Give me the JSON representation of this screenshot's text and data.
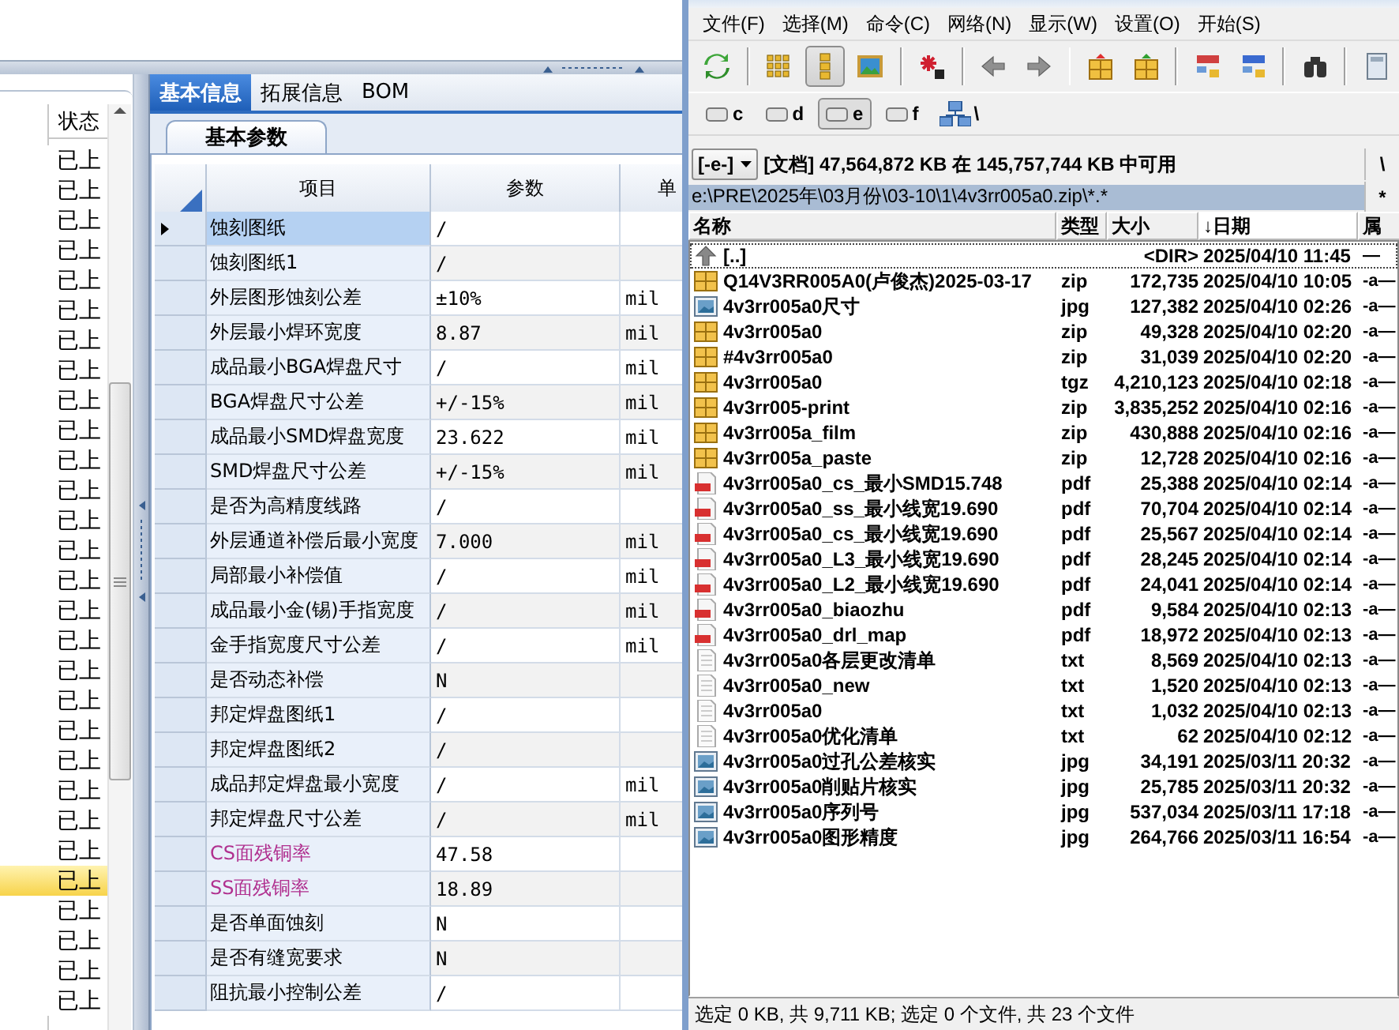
{
  "left_app": {
    "status_list": {
      "header": "状态",
      "rows": [
        {
          "text": "已上",
          "selected": false
        },
        {
          "text": "已上",
          "selected": false
        },
        {
          "text": "已上",
          "selected": false
        },
        {
          "text": "已上",
          "selected": false
        },
        {
          "text": "已上",
          "selected": false
        },
        {
          "text": "已上",
          "selected": false
        },
        {
          "text": "已上",
          "selected": false
        },
        {
          "text": "已上",
          "selected": false
        },
        {
          "text": "已上",
          "selected": false
        },
        {
          "text": "已上",
          "selected": false
        },
        {
          "text": "已上",
          "selected": false
        },
        {
          "text": "已上",
          "selected": false
        },
        {
          "text": "已上",
          "selected": false
        },
        {
          "text": "已上",
          "selected": false
        },
        {
          "text": "已上",
          "selected": false
        },
        {
          "text": "已上",
          "selected": false
        },
        {
          "text": "已上",
          "selected": false
        },
        {
          "text": "已上",
          "selected": false
        },
        {
          "text": "已上",
          "selected": false
        },
        {
          "text": "已上",
          "selected": false
        },
        {
          "text": "已上",
          "selected": false
        },
        {
          "text": "已上",
          "selected": false
        },
        {
          "text": "已上",
          "selected": false
        },
        {
          "text": "已上",
          "selected": false
        },
        {
          "text": "已上",
          "selected": true
        },
        {
          "text": "已上",
          "selected": false
        },
        {
          "text": "已上",
          "selected": false
        },
        {
          "text": "已上",
          "selected": false
        },
        {
          "text": "已上",
          "selected": false
        }
      ]
    },
    "tabs": [
      {
        "label": "基本信息",
        "selected": true
      },
      {
        "label": "拓展信息",
        "selected": false
      },
      {
        "label": "BOM",
        "selected": false
      }
    ],
    "sub_tabs": [
      {
        "label": "基本参数",
        "selected": true
      }
    ],
    "grid": {
      "columns": [
        "项目",
        "参数",
        "单"
      ],
      "rows": [
        {
          "item": "蚀刻图纸",
          "param": "/",
          "selected": true,
          "color": "#000000"
        },
        {
          "item": "蚀刻图纸1",
          "param": "/",
          "selected": false,
          "color": "#000000"
        },
        {
          "item": "外层图形蚀刻公差",
          "param": "±10%",
          "unit": "mil",
          "selected": false,
          "color": "#000000"
        },
        {
          "item": "外层最小焊环宽度",
          "param": "8.87",
          "unit": "mil",
          "selected": false,
          "color": "#000000"
        },
        {
          "item": "成品最小BGA焊盘尺寸",
          "param": "/",
          "unit": "mil",
          "selected": false,
          "color": "#000000"
        },
        {
          "item": "BGA焊盘尺寸公差",
          "param": "+/-15%",
          "unit": "mil",
          "selected": false,
          "color": "#000000"
        },
        {
          "item": "成品最小SMD焊盘宽度",
          "param": "23.622",
          "unit": "mil",
          "selected": false,
          "color": "#000000"
        },
        {
          "item": "SMD焊盘尺寸公差",
          "param": "+/-15%",
          "unit": "mil",
          "selected": false,
          "color": "#000000"
        },
        {
          "item": "是否为高精度线路",
          "param": "/",
          "selected": false,
          "color": "#000000"
        },
        {
          "item": "外层通道补偿后最小宽度",
          "param": "7.000",
          "unit": "mil",
          "selected": false,
          "color": "#000000"
        },
        {
          "item": "局部最小补偿值",
          "param": "/",
          "unit": "mil",
          "selected": false,
          "color": "#000000"
        },
        {
          "item": "成品最小金(锡)手指宽度",
          "param": "/",
          "unit": "mil",
          "selected": false,
          "color": "#000000"
        },
        {
          "item": "金手指宽度尺寸公差",
          "param": "/",
          "unit": "mil",
          "selected": false,
          "color": "#000000"
        },
        {
          "item": "是否动态补偿",
          "param": "N",
          "selected": false,
          "color": "#000000"
        },
        {
          "item": "邦定焊盘图纸1",
          "param": "/",
          "selected": false,
          "color": "#000000"
        },
        {
          "item": "邦定焊盘图纸2",
          "param": "/",
          "selected": false,
          "color": "#000000"
        },
        {
          "item": "成品邦定焊盘最小宽度",
          "param": "/",
          "unit": "mil",
          "selected": false,
          "color": "#000000"
        },
        {
          "item": "邦定焊盘尺寸公差",
          "param": "/",
          "unit": "mil",
          "selected": false,
          "color": "#000000"
        },
        {
          "item": "CS面残铜率",
          "param": "47.58",
          "selected": false,
          "color": "#b0308f"
        },
        {
          "item": "SS面残铜率",
          "param": "18.89",
          "selected": false,
          "color": "#b0308f"
        },
        {
          "item": "是否单面蚀刻",
          "param": "N",
          "selected": false,
          "color": "#000000"
        },
        {
          "item": "是否有缝宽要求",
          "param": "N",
          "selected": false,
          "color": "#000000"
        },
        {
          "item": "阻抗最小控制公差",
          "param": "/",
          "selected": false,
          "color": "#000000"
        }
      ]
    }
  },
  "file_manager": {
    "menu": [
      "文件(F)",
      "选择(M)",
      "命令(C)",
      "网络(N)",
      "显示(W)",
      "设置(O)",
      "开始(S)"
    ],
    "toolbar": [
      [
        {
          "pressed": false
        }
      ],
      [
        {
          "pressed": false
        },
        {
          "pressed": true
        },
        {
          "pressed": false
        }
      ],
      [
        {
          "pressed": false
        }
      ],
      [
        {
          "pressed": false
        },
        {
          "pressed": false
        }
      ],
      [
        {
          "pressed": false
        },
        {
          "pressed": false
        }
      ],
      [
        {
          "pressed": false
        },
        {
          "pressed": false
        }
      ],
      [
        {
          "pressed": false
        }
      ],
      [
        {
          "pressed": false
        }
      ]
    ],
    "drives": [
      {
        "label": "c",
        "selected": false
      },
      {
        "label": "d",
        "selected": false
      },
      {
        "label": "e",
        "selected": true
      },
      {
        "label": "f",
        "selected": false
      }
    ],
    "network_label": "\\",
    "drive_dropdown": "[-e-]",
    "free_space": "[文档] 47,564,872 KB 在 145,757,744 KB 中可用",
    "root_button": "\\",
    "path": "e:\\PRE\\2025年\\03月份\\03-10\\1\\4v3rr005a0.zip\\*.*",
    "history_button": "*",
    "columns": [
      {
        "label": "名称",
        "sorted": false
      },
      {
        "label": "类型",
        "sorted": false
      },
      {
        "label": "大小",
        "sorted": false
      },
      {
        "label": "↓日期",
        "sorted": true
      },
      {
        "label": "属",
        "sorted": false
      }
    ],
    "files": [
      {
        "kind": "up",
        "name": "[..]",
        "size": "<DIR>",
        "date": "2025/04/10 11:45",
        "attr": "—",
        "focused": true
      },
      {
        "kind": "archive",
        "name": "Q14V3RR005A0(卢俊杰)2025-03-17",
        "type": "zip",
        "size": "172,735",
        "date": "2025/04/10 10:05",
        "attr": "-a—",
        "focused": false
      },
      {
        "kind": "image",
        "name": "4v3rr005a0尺寸",
        "type": "jpg",
        "size": "127,382",
        "date": "2025/04/10 02:26",
        "attr": "-a—",
        "focused": false
      },
      {
        "kind": "archive",
        "name": "4v3rr005a0",
        "type": "zip",
        "size": "49,328",
        "date": "2025/04/10 02:20",
        "attr": "-a—",
        "focused": false
      },
      {
        "kind": "archive",
        "name": "#4v3rr005a0",
        "type": "zip",
        "size": "31,039",
        "date": "2025/04/10 02:20",
        "attr": "-a—",
        "focused": false
      },
      {
        "kind": "archive",
        "name": "4v3rr005a0",
        "type": "tgz",
        "size": "4,210,123",
        "date": "2025/04/10 02:18",
        "attr": "-a—",
        "focused": false
      },
      {
        "kind": "archive",
        "name": "4v3rr005-print",
        "type": "zip",
        "size": "3,835,252",
        "date": "2025/04/10 02:16",
        "attr": "-a—",
        "focused": false
      },
      {
        "kind": "archive",
        "name": "4v3rr005a_film",
        "type": "zip",
        "size": "430,888",
        "date": "2025/04/10 02:16",
        "attr": "-a—",
        "focused": false
      },
      {
        "kind": "archive",
        "name": "4v3rr005a_paste",
        "type": "zip",
        "size": "12,728",
        "date": "2025/04/10 02:16",
        "attr": "-a—",
        "focused": false
      },
      {
        "kind": "pdf",
        "name": "4v3rr005a0_cs_最小SMD15.748",
        "type": "pdf",
        "size": "25,388",
        "date": "2025/04/10 02:14",
        "attr": "-a—",
        "focused": false
      },
      {
        "kind": "pdf",
        "name": "4v3rr005a0_ss_最小线宽19.690",
        "type": "pdf",
        "size": "70,704",
        "date": "2025/04/10 02:14",
        "attr": "-a—",
        "focused": false
      },
      {
        "kind": "pdf",
        "name": "4v3rr005a0_cs_最小线宽19.690",
        "type": "pdf",
        "size": "25,567",
        "date": "2025/04/10 02:14",
        "attr": "-a—",
        "focused": false
      },
      {
        "kind": "pdf",
        "name": "4v3rr005a0_L3_最小线宽19.690",
        "type": "pdf",
        "size": "28,245",
        "date": "2025/04/10 02:14",
        "attr": "-a—",
        "focused": false
      },
      {
        "kind": "pdf",
        "name": "4v3rr005a0_L2_最小线宽19.690",
        "type": "pdf",
        "size": "24,041",
        "date": "2025/04/10 02:14",
        "attr": "-a—",
        "focused": false
      },
      {
        "kind": "pdf",
        "name": "4v3rr005a0_biaozhu",
        "type": "pdf",
        "size": "9,584",
        "date": "2025/04/10 02:13",
        "attr": "-a—",
        "focused": false
      },
      {
        "kind": "pdf",
        "name": "4v3rr005a0_drl_map",
        "type": "pdf",
        "size": "18,972",
        "date": "2025/04/10 02:13",
        "attr": "-a—",
        "focused": false
      },
      {
        "kind": "text",
        "name": "4v3rr005a0各层更改清单",
        "type": "txt",
        "size": "8,569",
        "date": "2025/04/10 02:13",
        "attr": "-a—",
        "focused": false
      },
      {
        "kind": "text",
        "name": "4v3rr005a0_new",
        "type": "txt",
        "size": "1,520",
        "date": "2025/04/10 02:13",
        "attr": "-a—",
        "focused": false
      },
      {
        "kind": "text",
        "name": "4v3rr005a0",
        "type": "txt",
        "size": "1,032",
        "date": "2025/04/10 02:13",
        "attr": "-a—",
        "focused": false
      },
      {
        "kind": "text",
        "name": "4v3rr005a0优化清单",
        "type": "txt",
        "size": "62",
        "date": "2025/04/10 02:12",
        "attr": "-a—",
        "focused": false
      },
      {
        "kind": "image",
        "name": "4v3rr005a0过孔公差核实",
        "type": "jpg",
        "size": "34,191",
        "date": "2025/03/11 20:32",
        "attr": "-a—",
        "focused": false
      },
      {
        "kind": "image",
        "name": "4v3rr005a0削贴片核实",
        "type": "jpg",
        "size": "25,785",
        "date": "2025/03/11 20:32",
        "attr": "-a—",
        "focused": false
      },
      {
        "kind": "image",
        "name": "4v3rr005a0序列号",
        "type": "jpg",
        "size": "537,034",
        "date": "2025/03/11 17:18",
        "attr": "-a—",
        "focused": false
      },
      {
        "kind": "image",
        "name": "4v3rr005a0图形精度",
        "type": "jpg",
        "size": "264,766",
        "date": "2025/03/11 16:54",
        "attr": "-a—",
        "focused": false
      }
    ],
    "status": "选定 0 KB, 共 9,711 KB; 选定 0 个文件, 共 23 个文件"
  }
}
